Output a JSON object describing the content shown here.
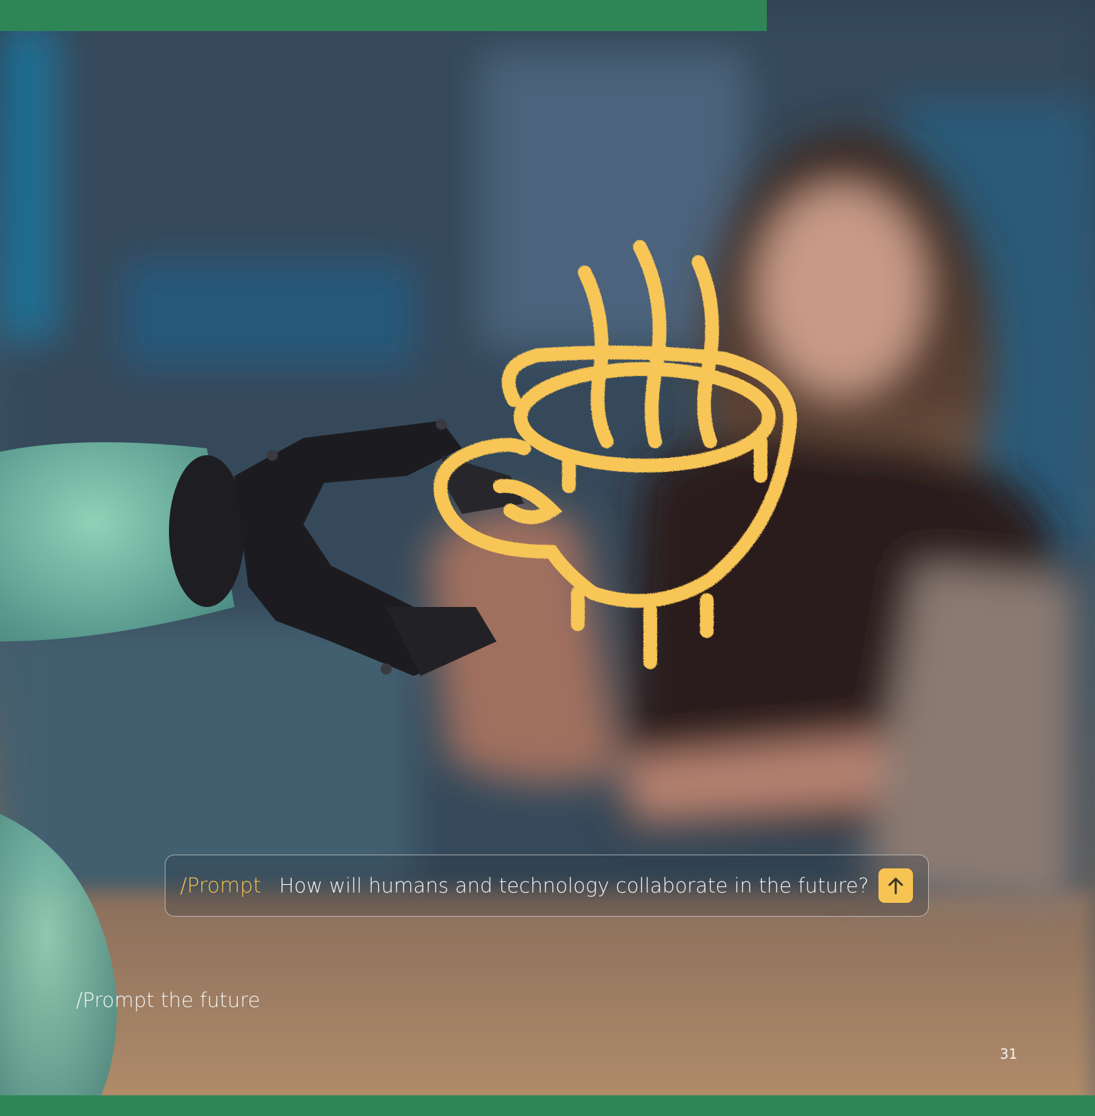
{
  "prompt_bar": {
    "label": "/Prompt",
    "text": "How will humans and technology collaborate in the future?",
    "send_icon": "arrow-up-icon"
  },
  "caption": "/Prompt the future",
  "page_number": "31",
  "colors": {
    "brand_green": "#2e8657",
    "accent_yellow": "#f7c453",
    "text_light": "#f4f4f4"
  },
  "illustration": {
    "icon": "coffee-cup-icon",
    "robot": "robot-gripper-icon"
  }
}
